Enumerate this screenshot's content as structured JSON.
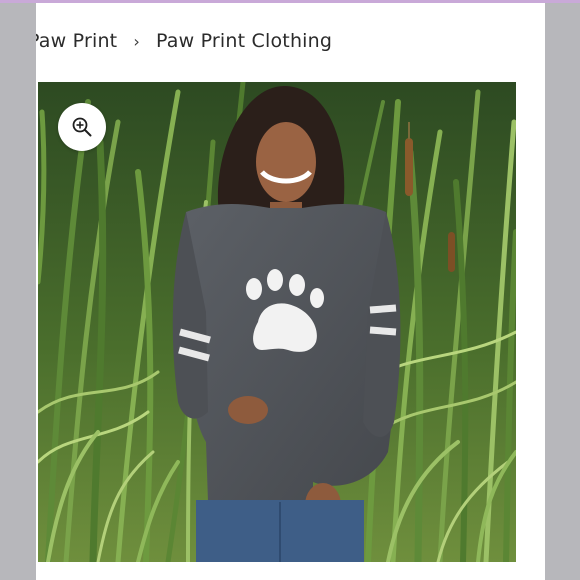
{
  "breadcrumb": {
    "items": [
      {
        "label": "Paw Print"
      },
      {
        "label": "Paw Print Clothing"
      }
    ],
    "separator": "›"
  },
  "product_image": {
    "zoom_icon": "zoom-in-icon"
  },
  "colors": {
    "top_strip": "#c9a9d8",
    "side_background": "#b7b7bb",
    "sweatshirt": "#56595e"
  }
}
